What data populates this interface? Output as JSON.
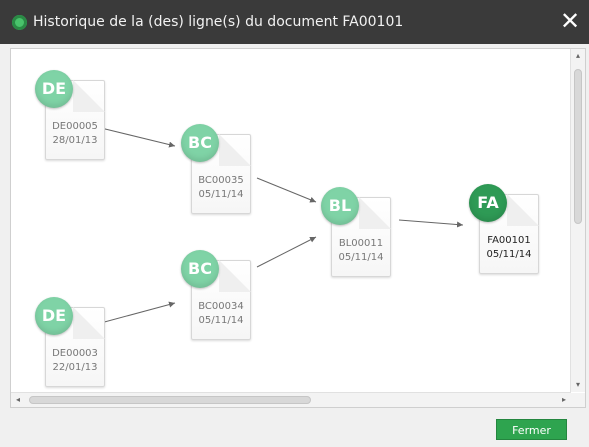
{
  "window": {
    "title": "Historique de la (des) ligne(s) du document FA00101",
    "close_symbol": "✕"
  },
  "nodes": [
    {
      "badge": "DE",
      "code": "DE00005",
      "date": "28/01/13"
    },
    {
      "badge": "BC",
      "code": "BC00035",
      "date": "05/11/14"
    },
    {
      "badge": "BL",
      "code": "BL00011",
      "date": "05/11/14"
    },
    {
      "badge": "FA",
      "code": "FA00101",
      "date": "05/11/14"
    },
    {
      "badge": "BC",
      "code": "BC00034",
      "date": "05/11/14"
    },
    {
      "badge": "DE",
      "code": "DE00003",
      "date": "22/01/13"
    }
  ],
  "scrollbars": {
    "vertical_arrows": {
      "up": "▴",
      "down": "▾"
    },
    "horizontal_arrows": {
      "left": "◂",
      "right": "▸"
    },
    "grip": "III"
  },
  "footer": {
    "close_label": "Fermer"
  },
  "colors": {
    "title_bg": "#3a3a3a",
    "badge_light": "#7fd3a6",
    "badge_dark": "#2e9a55",
    "button_green": "#2ea44f"
  }
}
